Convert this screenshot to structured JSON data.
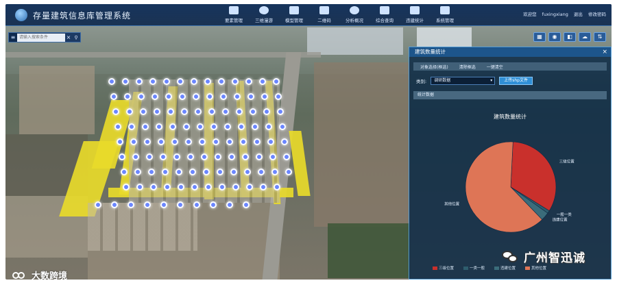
{
  "header": {
    "title": "存量建筑信息库管理系统",
    "nav": [
      {
        "label": "要素管理",
        "icon": "briefcase-icon"
      },
      {
        "label": "三维漫游",
        "icon": "globe-icon"
      },
      {
        "label": "模型管理",
        "icon": "database-icon"
      },
      {
        "label": "二维码",
        "icon": "qrcode-icon"
      },
      {
        "label": "分析概况",
        "icon": "pie-icon"
      },
      {
        "label": "综合查询",
        "icon": "search-doc-icon"
      },
      {
        "label": "违建统计",
        "icon": "bar-chart-icon"
      },
      {
        "label": "系统管理",
        "icon": "monitor-icon"
      }
    ],
    "user": {
      "welcome": "欢迎您",
      "username": "fuxingxiang",
      "logout": "退出",
      "change_password": "修改密码"
    }
  },
  "search": {
    "placeholder": "请输入搜索条件",
    "clear": "×",
    "menu": "≡"
  },
  "tools": [
    "grid-icon",
    "eye-icon",
    "layer-icon",
    "cloud-icon",
    "swap-icon"
  ],
  "panel": {
    "title": "建筑数量统计",
    "close": "×",
    "tabs": [
      "对象选择(框选)",
      "清除框选",
      "一键清空"
    ],
    "filter_label": "类别:",
    "filter_value": "调研数据",
    "upload_label": "上传shp文件",
    "stats_label": "统计数据"
  },
  "chart_data": {
    "type": "pie",
    "title": "建筑数量统计",
    "slices": [
      {
        "label": "三级位置",
        "value": 33,
        "color": "#c9302c"
      },
      {
        "label": "一般一类",
        "value": 1,
        "color": "#2e5d6d"
      },
      {
        "label": "违建位置",
        "value": 3,
        "color": "#3b6c7a"
      },
      {
        "label": "其他位置",
        "value": 63,
        "color": "#de7556"
      }
    ],
    "legend": [
      "三级位置",
      "一类一般",
      "违建位置",
      "其他位置"
    ]
  },
  "watermarks": {
    "right": "广州智迅诚",
    "left": "大数跨境"
  }
}
